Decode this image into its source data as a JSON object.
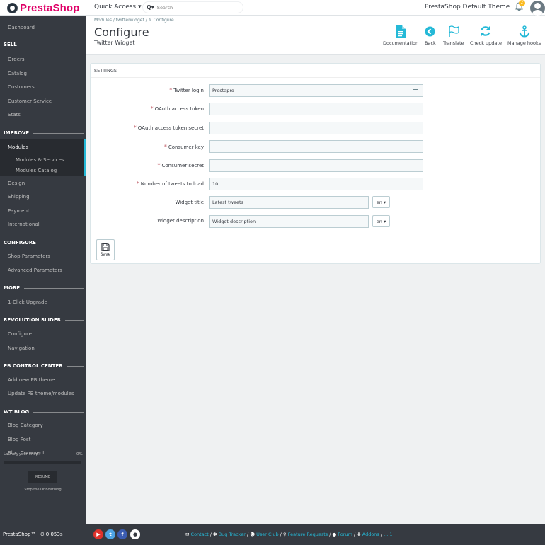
{
  "app": {
    "logo_text": "PrestaShop",
    "quick_access_label": "Quick Access ▾",
    "search_placeholder": "Search",
    "shop_name": "PrestaShop Default Theme",
    "notification_count": "2"
  },
  "sidebar": {
    "dashboard": "Dashboard",
    "sections": {
      "sell": "SELL",
      "improve": "IMPROVE",
      "configure": "CONFIGURE",
      "more": "MORE",
      "revolution_slider": "REVOLUTION SLIDER",
      "pb_control_center": "PB CONTROL CENTER",
      "wt_blog": "WT BLOG"
    },
    "items": {
      "orders": "Orders",
      "catalog": "Catalog",
      "customers": "Customers",
      "customer_service": "Customer Service",
      "stats": "Stats",
      "modules": "Modules",
      "modules_services": "Modules & Services",
      "modules_catalog": "Modules Catalog",
      "design": "Design",
      "shipping": "Shipping",
      "payment": "Payment",
      "international": "International",
      "shop_parameters": "Shop Parameters",
      "advanced_parameters": "Advanced Parameters",
      "one_click_upgrade": "1-Click Upgrade",
      "rs_configure": "Configure",
      "rs_navigation": "Navigation",
      "add_pb_theme": "Add new PB theme",
      "update_pb": "Update PB theme/modules",
      "blog_category": "Blog Category",
      "blog_post": "Blog Post",
      "blog_comment": "Blog Comment"
    },
    "onboarding": {
      "launch_label": "Launch your shop!",
      "progress_text": "0%",
      "progress_value": 0,
      "resume_label": "RESUME",
      "stop_label": "Stop the OnBoarding"
    }
  },
  "header": {
    "breadcrumb": "Modules  /  twitterwidget  /  ✎ Configure",
    "title": "Configure",
    "subtitle": "Twitter Widget",
    "toolbar": {
      "documentation": "Documentation",
      "back": "Back",
      "translate": "Translate",
      "check_update": "Check update",
      "manage_hooks": "Manage hooks"
    }
  },
  "settings": {
    "panel_title": "SETTINGS",
    "required_mark": "*",
    "fields": {
      "twitter_login": {
        "label": "Twitter login",
        "value": "Prestapro"
      },
      "oauth_token": {
        "label": "OAuth access token",
        "value": ""
      },
      "oauth_secret": {
        "label": "OAuth access token secret",
        "value": ""
      },
      "consumer_key": {
        "label": "Consumer key",
        "value": ""
      },
      "consumer_secret": {
        "label": "Consumer secret",
        "value": ""
      },
      "tweets_count": {
        "label": "Number of tweets to load",
        "value": "10"
      },
      "widget_title": {
        "label": "Widget title",
        "value": "Latest tweets",
        "lang": "en ▾"
      },
      "widget_description": {
        "label": "Widget description",
        "value": "Widget description",
        "lang": "en ▾"
      }
    },
    "save_label": "Save"
  },
  "footer": {
    "version": "PrestaShop™ · ⏱ 0.053s",
    "links": {
      "contact": "Contact",
      "bug_tracker": "Bug Tracker",
      "user_club": "User Club",
      "feature_requests": "Feature Requests",
      "forum": "Forum",
      "addons": "Addons",
      "more": "... 1"
    }
  },
  "colors": {
    "accent": "#25b9d7",
    "brand": "#df0067",
    "sidebar_bg": "#363a41",
    "required": "#c05c67"
  },
  "icons": [
    "prestashop-logo-icon",
    "search-icon",
    "bell-icon",
    "avatar-icon",
    "document-icon",
    "back-arrow-icon",
    "flag-icon",
    "refresh-icon",
    "anchor-icon",
    "id-card-icon",
    "save-icon",
    "youtube-icon",
    "twitter-icon",
    "facebook-icon",
    "github-icon",
    "envelope-icon",
    "bug-icon",
    "users-icon",
    "lightbulb-icon",
    "comments-icon",
    "puzzle-icon"
  ]
}
